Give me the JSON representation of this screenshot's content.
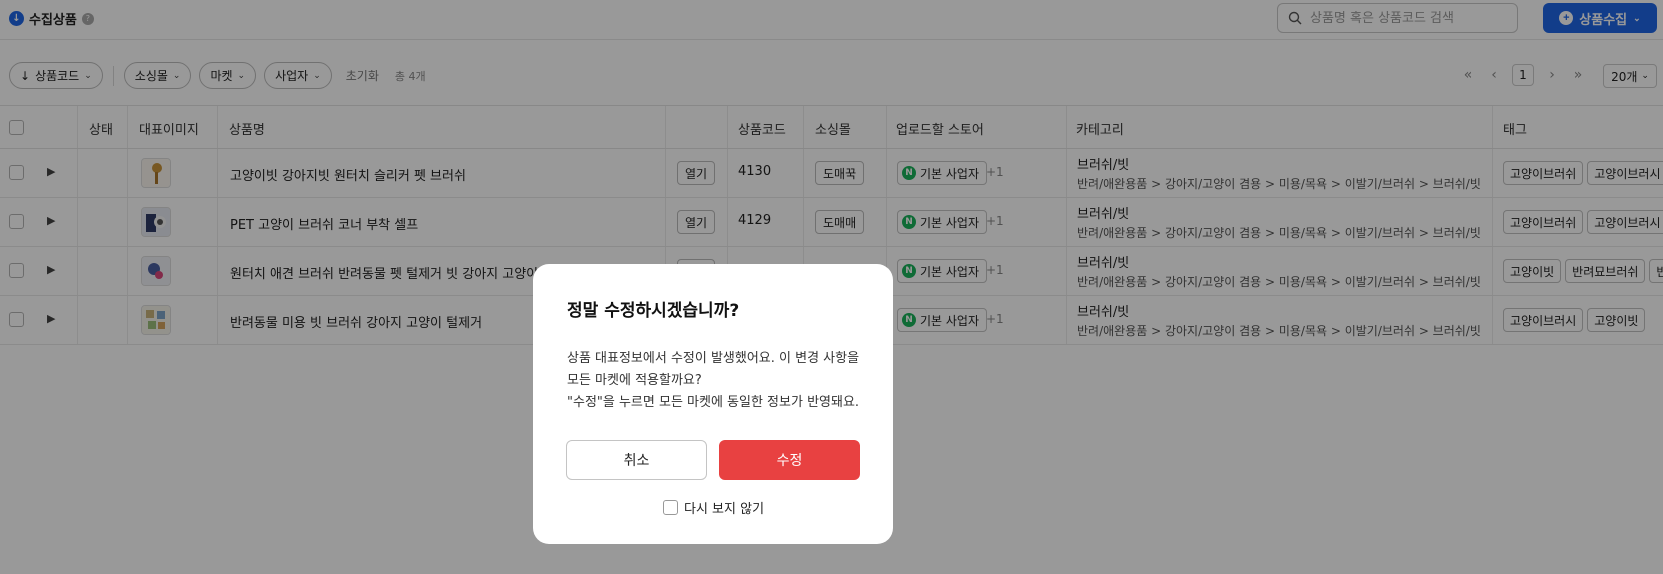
{
  "header": {
    "title": "수집상품",
    "search_placeholder": "상품명 혹은 상품코드 검색",
    "collect_button": "상품수집"
  },
  "filters": {
    "sort_chip": "상품코드",
    "chips": [
      "소싱몰",
      "마켓",
      "사업자"
    ],
    "reset": "초기화",
    "total": "총 4개"
  },
  "pagination": {
    "current_page": "1",
    "per_page": "20개"
  },
  "table": {
    "columns": {
      "status": "상태",
      "image": "대표이미지",
      "name": "상품명",
      "code": "상품코드",
      "source": "소싱몰",
      "store": "업로드할 스토어",
      "category": "카테고리",
      "tag": "태그"
    },
    "open_label": "열기",
    "rows": [
      {
        "name": "고양이빗 강아지빗 원터치 슬리커 펫 브러쉬",
        "code": "4130",
        "source": "도매꾹",
        "store": "기본 사업자",
        "store_extra": "+1",
        "category": "브러쉬/빗",
        "category_path": "반려/애완용품 > 강아지/고양이 겸용 > 미용/목욕 > 이발기/브러쉬 > 브러쉬/빗",
        "tags": [
          "고양이브러쉬",
          "고양이브러시"
        ]
      },
      {
        "name": "PET 고양이 브러쉬 코너 부착 셀프",
        "code": "4129",
        "source": "도매매",
        "store": "기본 사업자",
        "store_extra": "+1",
        "category": "브러쉬/빗",
        "category_path": "반려/애완용품 > 강아지/고양이 겸용 > 미용/목욕 > 이발기/브러쉬 > 브러쉬/빗",
        "tags": [
          "고양이브러쉬",
          "고양이브러시"
        ]
      },
      {
        "name": "원터치 애견 브러쉬 반려동물 펫 털제거 빗 강아지 고양이",
        "code": "",
        "source": "",
        "store": "기본 사업자",
        "store_extra": "+1",
        "category": "브러쉬/빗",
        "category_path": "반려/애완용품 > 강아지/고양이 겸용 > 미용/목욕 > 이발기/브러쉬 > 브러쉬/빗",
        "tags": [
          "고양이빗",
          "반려묘브러쉬",
          "반"
        ]
      },
      {
        "name": "반려동물 미용 빗 브러쉬 강아지 고양이 털제거",
        "code": "",
        "source": "",
        "store": "기본 사업자",
        "store_extra": "+1",
        "category": "브러쉬/빗",
        "category_path": "반려/애완용품 > 강아지/고양이 겸용 > 미용/목욕 > 이발기/브러쉬 > 브러쉬/빗",
        "tags": [
          "고양이브러시",
          "고양이빗"
        ]
      }
    ]
  },
  "modal": {
    "title": "정말 수정하시겠습니까?",
    "line1": "상품 대표정보에서 수정이 발생했어요. 이 변경 사항을",
    "line2": "모든 마켓에 적용할까요?",
    "line3": "\"수정\"을 누르면 모든 마켓에 동일한 정보가 반영돼요.",
    "cancel": "취소",
    "confirm": "수정",
    "dont_show": "다시 보지 않기"
  },
  "colors": {
    "primary": "#1e66e6",
    "danger": "#e84141",
    "naver_green": "#19b35b"
  }
}
